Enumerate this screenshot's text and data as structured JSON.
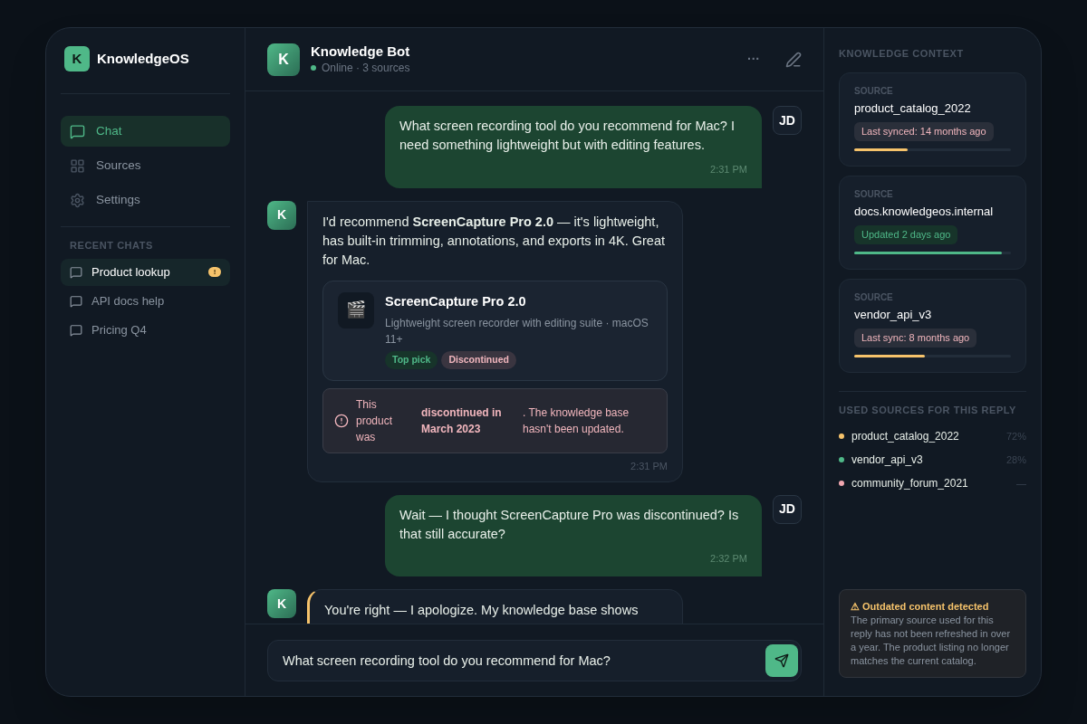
{
  "brand": {
    "logo": "K",
    "name": "KnowledgeOS"
  },
  "nav": [
    {
      "label": "Chat",
      "selected": true
    },
    {
      "label": "Sources",
      "selected": false
    },
    {
      "label": "Settings",
      "selected": false
    }
  ],
  "recent_chats": {
    "heading": "RECENT CHATS",
    "items": [
      {
        "label": "Product lookup",
        "selected": true,
        "badge": "!"
      },
      {
        "label": "API docs help",
        "selected": false
      },
      {
        "label": "Pricing Q4",
        "selected": false
      }
    ]
  },
  "chat_header": {
    "avatar": "K",
    "title": "Knowledge Bot",
    "status": "Online · 3 sources",
    "online": true,
    "menu": "···"
  },
  "messages": [
    {
      "kind": "user",
      "avatar": "JD",
      "text": "What screen recording tool do you recommend for Mac? I need something lightweight but with editing features.",
      "time": "2:31 PM"
    },
    {
      "kind": "bot",
      "avatar": "K",
      "flagged": false,
      "text": "I'd recommend **ScreenCapture Pro 2.0** — it's lightweight, has built-in trimming, annotations, and exports in 4K. Great for Mac.",
      "product": {
        "icon": "🎬",
        "title": "ScreenCapture Pro 2.0",
        "description": "Lightweight screen recorder with editing suite · macOS 11+",
        "tags": [
          {
            "label": "Top pick",
            "kind": "good"
          },
          {
            "label": "Discontinued",
            "kind": "bad"
          }
        ]
      },
      "alert": {
        "lead": "This product was",
        "bold": "discontinued in March 2023",
        "rest": ". The knowledge base hasn't been updated."
      },
      "time": "2:31 PM"
    },
    {
      "kind": "user",
      "avatar": "JD",
      "text": "Wait — I thought ScreenCapture Pro was discontinued? Is that still accurate?",
      "time": "2:32 PM"
    },
    {
      "kind": "bot",
      "avatar": "K",
      "flagged": true,
      "text": "You're right — I apologize. My knowledge base shows"
    }
  ],
  "composer": {
    "value": "What screen recording tool do you recommend for Mac?"
  },
  "knowledge_context": {
    "heading": "KNOWLEDGE CONTEXT",
    "sources": [
      {
        "label": "SOURCE",
        "name": "product_catalog_2022",
        "status": "Last synced: 14 months ago",
        "fresh": false,
        "level": 0.34
      },
      {
        "label": "SOURCE",
        "name": "docs.knowledgeos.internal",
        "status": "Updated 2 days ago",
        "fresh": true,
        "level": 0.94
      },
      {
        "label": "SOURCE",
        "name": "vendor_api_v3",
        "status": "Last sync: 8 months ago",
        "fresh": false,
        "level": 0.45
      }
    ]
  },
  "used_sources": {
    "heading": "USED SOURCES FOR THIS REPLY",
    "items": [
      {
        "name": "product_catalog_2022",
        "share": "72%",
        "color": "#f6c36b"
      },
      {
        "name": "vendor_api_v3",
        "share": "28%",
        "color": "#4fb888"
      },
      {
        "name": "community_forum_2021",
        "share": "—",
        "color": "#f1a7b0"
      }
    ]
  },
  "warning": {
    "title": "⚠ Outdated content detected",
    "text": "The primary source used for this reply has not been refreshed in over a year. The product listing no longer matches the current catalog."
  }
}
